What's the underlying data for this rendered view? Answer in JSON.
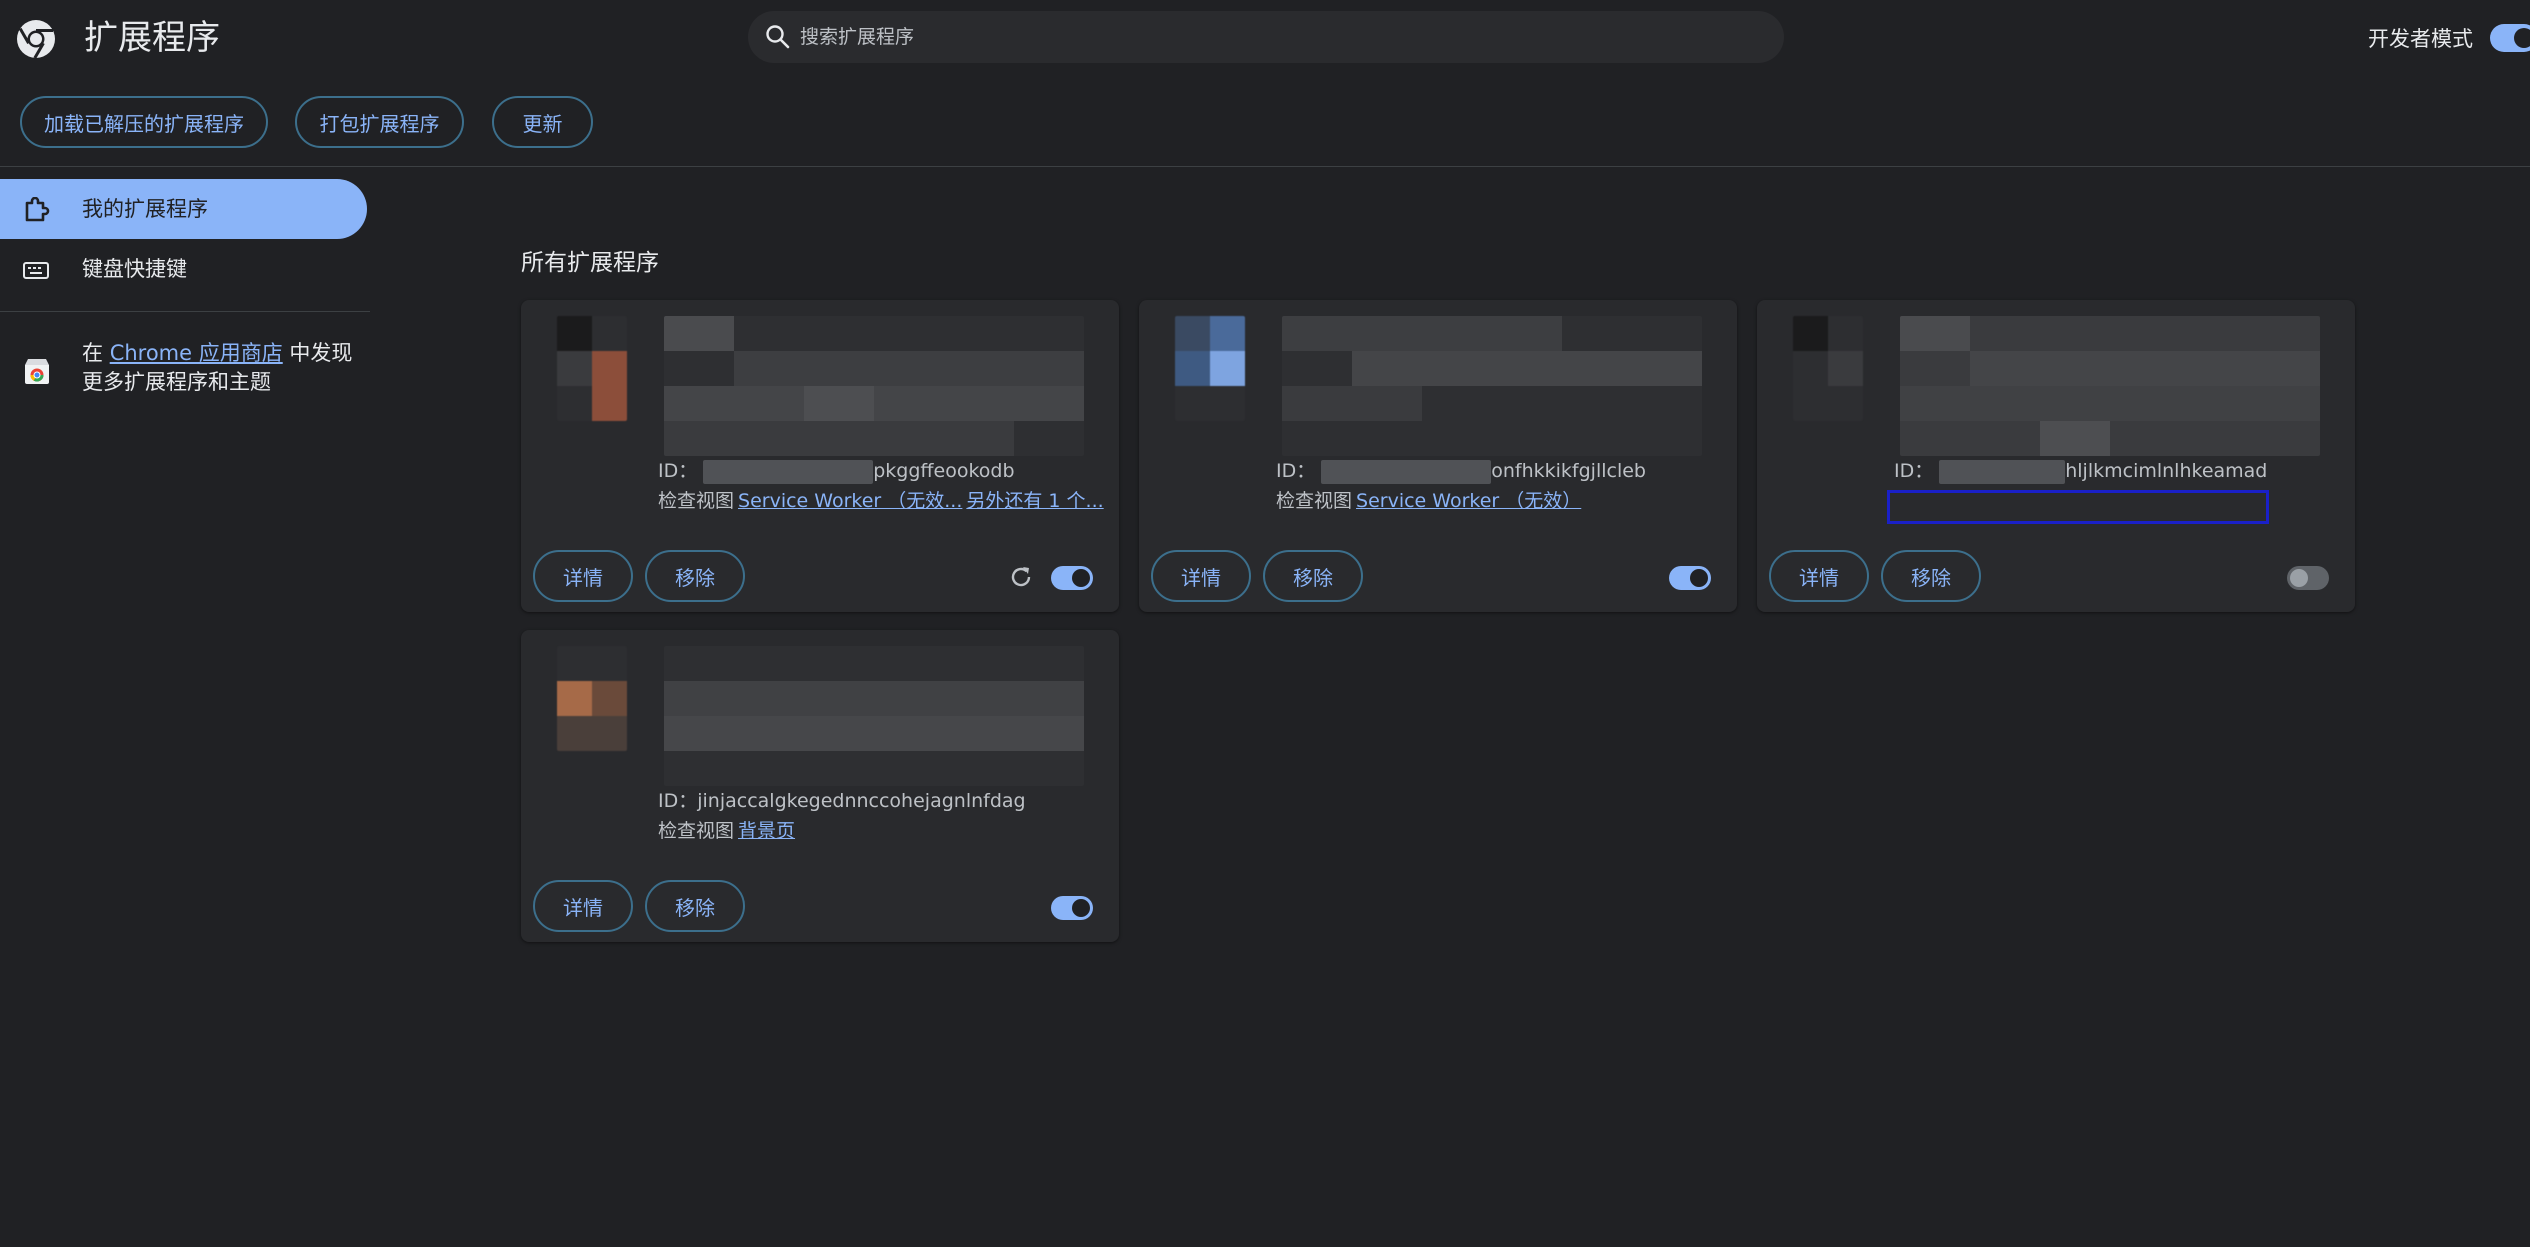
{
  "header": {
    "title": "扩展程序",
    "search_placeholder": "搜索扩展程序",
    "dev_mode_label": "开发者模式",
    "dev_mode_on": true
  },
  "toolbar": {
    "load_unpacked": "加载已解压的扩展程序",
    "pack": "打包扩展程序",
    "update": "更新"
  },
  "sidebar": {
    "items": [
      {
        "label": "我的扩展程序",
        "active": true
      },
      {
        "label": "键盘快捷键",
        "active": false
      }
    ],
    "store_prefix": "在 ",
    "store_link": "Chrome 应用商店",
    "store_suffix": " 中发现更多扩展程序和主题"
  },
  "main": {
    "section_title": "所有扩展程序",
    "card_details_label": "详情",
    "card_remove_label": "移除",
    "inspect_prefix": "检查视图",
    "id_prefix": "ID：",
    "cards": [
      {
        "id_suffix": "pkggffeookodb",
        "inspect_link": "Service Worker （无效...",
        "inspect_extra": "另外还有 1 个...",
        "enabled": true,
        "has_reload": true
      },
      {
        "id_suffix": "onfhkkikfgjllcleb",
        "inspect_link": "Service Worker （无效）",
        "inspect_extra": "",
        "enabled": true,
        "has_reload": false
      },
      {
        "id_suffix": "hljlkmcimlnlhkeamad",
        "inspect_link": "",
        "inspect_extra": "",
        "enabled": false,
        "has_reload": false
      },
      {
        "id_full": "jinjaccalgkegednnccohejagnlnfdag",
        "inspect_link": "背景页",
        "inspect_extra": "",
        "enabled": true,
        "has_reload": false
      }
    ]
  },
  "colors": {
    "background": "#202124",
    "card": "#292a2d",
    "accent": "#8ab4f8",
    "highlight": "#1a20c8"
  }
}
